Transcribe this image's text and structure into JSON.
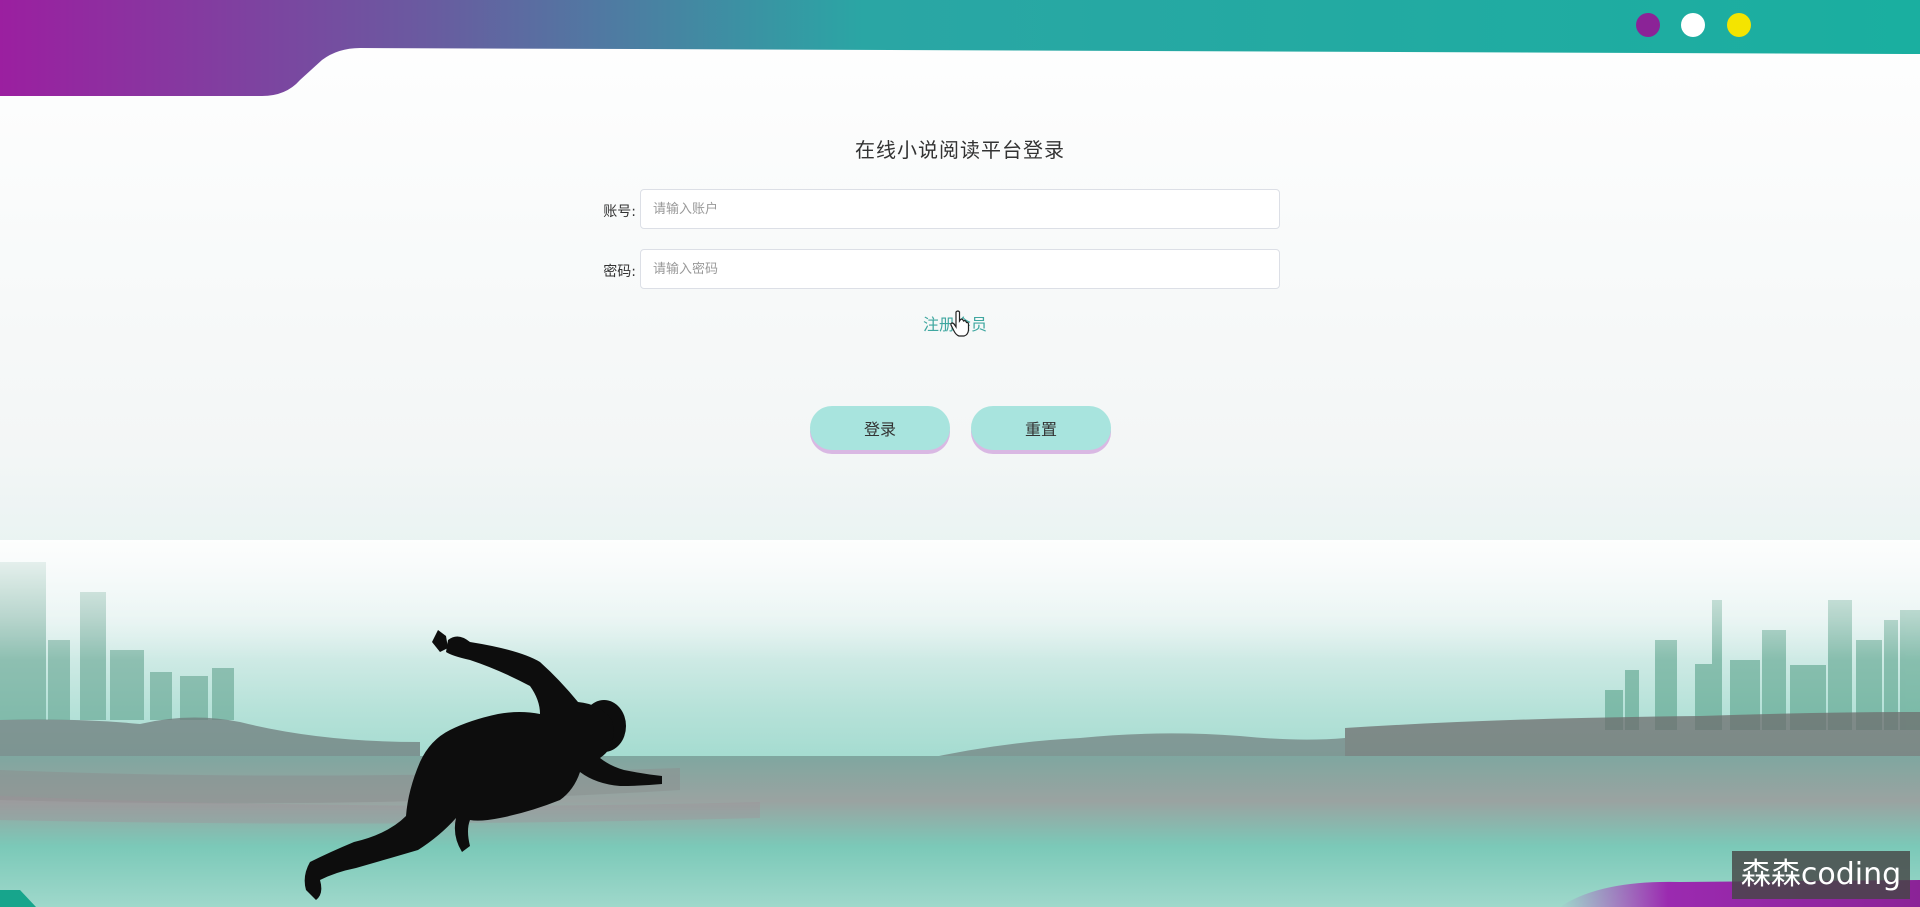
{
  "header": {
    "dots": [
      {
        "name": "purple",
        "color": "#8b2397"
      },
      {
        "name": "white",
        "color": "#ffffff"
      },
      {
        "name": "yellow",
        "color": "#f4e400"
      }
    ]
  },
  "login": {
    "title": "在线小说阅读平台登录",
    "account_label": "账号:",
    "account_placeholder": "请输入账户",
    "password_label": "密码:",
    "password_placeholder": "请输入密码",
    "register_link": "注册会员",
    "login_button": "登录",
    "reset_button": "重置"
  },
  "watermark": "森森coding",
  "colors": {
    "accent": "#3fa7a0",
    "button": "#a8e4de",
    "header_start": "#9b1fa0",
    "header_end": "#1aafa0"
  }
}
